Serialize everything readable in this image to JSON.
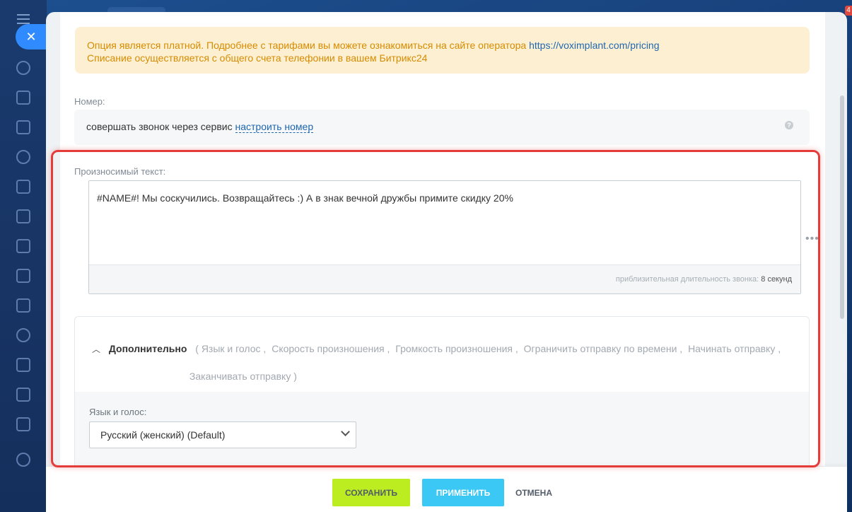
{
  "window": {
    "notification_count": "4"
  },
  "notice": {
    "line1_text": "Опция является платной. Подробнее с тарифами вы можете ознакомиться на сайте оператора",
    "link": "https://voximplant.com/pricing",
    "line2_text": "Списание осуществляется с общего счета телефонии в вашем Битрикс24"
  },
  "number": {
    "label": "Номер:",
    "text": "совершать звонок через сервис",
    "link": "настроить номер",
    "help": "?"
  },
  "speech": {
    "label": "Произносимый текст:",
    "value": "#NAME#! Мы соскучились. Возвращайтесь :) А в знак вечной дружбы примите скидку 20%",
    "duration_label": "приблизительная длительность звонка:",
    "duration_value": "8 секунд",
    "more": "•••"
  },
  "additional": {
    "title": "Дополнительно",
    "items": [
      "( Язык и голос ,",
      "Скорость произношения ,",
      "Громкость произношения ,",
      "Ограничить отправку по времени ,",
      "Начинать отправку ,",
      "Заканчивать отправку  )"
    ],
    "voice_label": "Язык и голос:",
    "voice_value": "Русский (женский) (Default)"
  },
  "footer": {
    "save": "СОХРАНИТЬ",
    "apply": "ПРИМЕНИТЬ",
    "cancel": "ОТМЕНА"
  },
  "colors": {
    "save": "#bbed21",
    "apply": "#3bc8f5",
    "highlight": "#e53b3b",
    "notice_bg": "#fdf0d2",
    "link": "#2067b0"
  }
}
